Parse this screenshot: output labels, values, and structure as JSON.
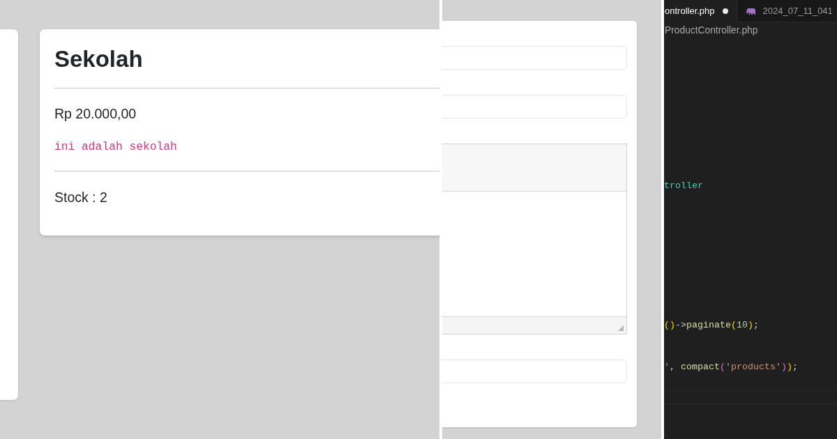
{
  "product_card": {
    "title": "Sekolah",
    "price": "Rp 20.000,00",
    "description": "ini adalah sekolah",
    "stock": "Stock : 2"
  },
  "form": {
    "fields": [
      {
        "kind": "input"
      },
      {
        "kind": "input"
      },
      {
        "kind": "rich_text"
      },
      {
        "kind": "input"
      }
    ]
  },
  "editor": {
    "tabs": [
      {
        "label": "ontroller.php",
        "selected": true,
        "modified": true,
        "file_icon": false
      },
      {
        "label": "2024_07_11_041",
        "selected": false,
        "modified": false,
        "file_icon": true
      }
    ],
    "breadcrumb": "ProductController.php",
    "code_lines": [
      {
        "tokens": [
          {
            "kind": "class",
            "text": "troller"
          }
        ]
      },
      {
        "tokens": [
          {
            "kind": "bracket1",
            "text": "()"
          },
          {
            "kind": "plain",
            "text": "->"
          },
          {
            "kind": "function",
            "text": "paginate"
          },
          {
            "kind": "bracket1",
            "text": "("
          },
          {
            "kind": "number",
            "text": "10"
          },
          {
            "kind": "bracket1",
            "text": ")"
          },
          {
            "kind": "plain",
            "text": ";"
          }
        ]
      },
      {
        "tokens": [
          {
            "kind": "string",
            "text": "'"
          },
          {
            "kind": "plain",
            "text": ", "
          },
          {
            "kind": "function",
            "text": "compact"
          },
          {
            "kind": "bracket2",
            "text": "("
          },
          {
            "kind": "string",
            "text": "'products'"
          },
          {
            "kind": "bracket2",
            "text": ")"
          },
          {
            "kind": "bracket1",
            "text": ")"
          },
          {
            "kind": "plain",
            "text": ";"
          }
        ]
      }
    ]
  }
}
